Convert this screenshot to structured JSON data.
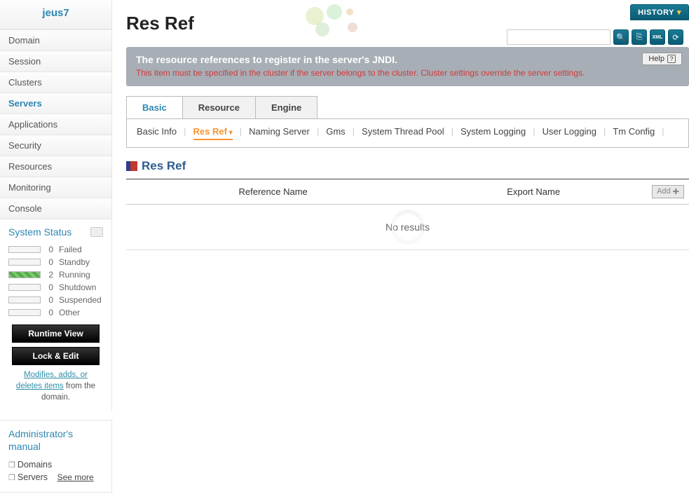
{
  "sidebar": {
    "title": "jeus7",
    "items": [
      {
        "label": "Domain"
      },
      {
        "label": "Session"
      },
      {
        "label": "Clusters"
      },
      {
        "label": "Servers",
        "active": true
      },
      {
        "label": "Applications"
      },
      {
        "label": "Security"
      },
      {
        "label": "Resources"
      },
      {
        "label": "Monitoring"
      },
      {
        "label": "Console"
      }
    ],
    "status": {
      "title": "System Status",
      "rows": [
        {
          "count": "0",
          "label": "Failed",
          "filled": false
        },
        {
          "count": "0",
          "label": "Standby",
          "filled": false
        },
        {
          "count": "2",
          "label": "Running",
          "filled": true
        },
        {
          "count": "0",
          "label": "Shutdown",
          "filled": false
        },
        {
          "count": "0",
          "label": "Suspended",
          "filled": false
        },
        {
          "count": "0",
          "label": "Other",
          "filled": false
        }
      ]
    },
    "buttons": {
      "runtime": "Runtime View",
      "lockedit": "Lock & Edit"
    },
    "edit_link": "Modifies, adds, or deletes items",
    "edit_suffix": " from the domain.",
    "manual": {
      "title": "Administrator's manual",
      "items": [
        "Domains",
        "Servers"
      ],
      "seemore": "See more"
    }
  },
  "header": {
    "history": "HISTORY"
  },
  "page": {
    "title": "Res Ref"
  },
  "banner": {
    "title": "The resource references to register in the server's JNDI.",
    "msg": "This item must be specified in the cluster if the server belongs to the cluster. Cluster settings override the server settings.",
    "help": "Help"
  },
  "tabs": [
    "Basic",
    "Resource",
    "Engine"
  ],
  "subtabs": [
    "Basic Info",
    "Res Ref",
    "Naming Server",
    "Gms",
    "System Thread Pool",
    "System Logging",
    "User Logging",
    "Tm Config"
  ],
  "section": {
    "title": "Res Ref"
  },
  "table": {
    "cols": [
      "Reference Name",
      "Export Name"
    ],
    "add": "Add",
    "noresults": "No results"
  }
}
